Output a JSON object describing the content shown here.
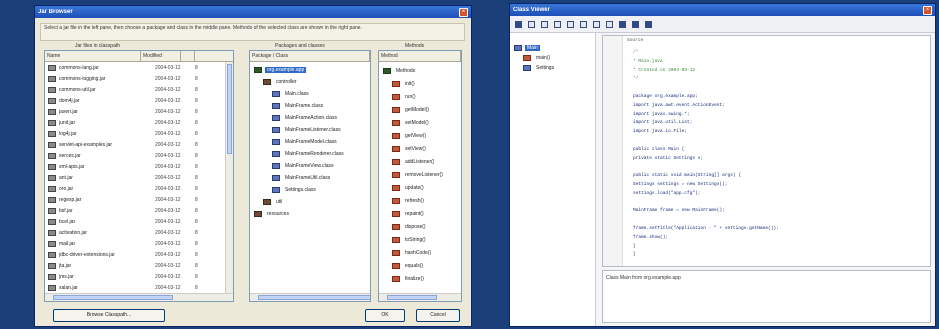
{
  "left_window": {
    "title": "Jar Browser",
    "close_glyph": "×",
    "description": "Select a jar file in the left pane, then choose a package and class in the middle pane. Methods of the selected class are shown in the right pane.",
    "files_group_label": "Jar files in classpath",
    "tree_group_label": "Packages and classes",
    "methods_group_label": "Methods",
    "files_headers": {
      "name": "Name",
      "date": "Modified",
      "size": ""
    },
    "files": [
      {
        "name": "commons-lang.jar",
        "date": "2004-03-12",
        "size": "8"
      },
      {
        "name": "commons-logging.jar",
        "date": "2004-03-12",
        "size": "8"
      },
      {
        "name": "commons-util.jar",
        "date": "2004-03-12",
        "size": "8"
      },
      {
        "name": "dom4j.jar",
        "date": "2004-03-12",
        "size": "8"
      },
      {
        "name": "jaxen.jar",
        "date": "2004-03-12",
        "size": "8"
      },
      {
        "name": "junit.jar",
        "date": "2004-03-12",
        "size": "8"
      },
      {
        "name": "log4j.jar",
        "date": "2004-03-12",
        "size": "8"
      },
      {
        "name": "servlet-api-examples.jar",
        "date": "2004-03-12",
        "size": "8"
      },
      {
        "name": "xerces.jar",
        "date": "2004-03-12",
        "size": "8"
      },
      {
        "name": "xml-apis.jar",
        "date": "2004-03-12",
        "size": "8"
      },
      {
        "name": "ant.jar",
        "date": "2004-03-12",
        "size": "8"
      },
      {
        "name": "oro.jar",
        "date": "2004-03-12",
        "size": "8"
      },
      {
        "name": "regexp.jar",
        "date": "2004-03-12",
        "size": "8"
      },
      {
        "name": "bsf.jar",
        "date": "2004-03-12",
        "size": "8"
      },
      {
        "name": "bcel.jar",
        "date": "2004-03-12",
        "size": "8"
      },
      {
        "name": "activation.jar",
        "date": "2004-03-12",
        "size": "8"
      },
      {
        "name": "mail.jar",
        "date": "2004-03-12",
        "size": "8"
      },
      {
        "name": "jdbc-driver-extensions.jar",
        "date": "2004-03-12",
        "size": "8"
      },
      {
        "name": "jta.jar",
        "date": "2004-03-12",
        "size": "8"
      },
      {
        "name": "jms.jar",
        "date": "2004-03-12",
        "size": "8"
      },
      {
        "name": "xalan.jar",
        "date": "2004-03-12",
        "size": "8"
      }
    ],
    "tree_header": "Package / Class",
    "tree": [
      {
        "label": "org.example.app",
        "level": 0,
        "icon": "root",
        "selected": true
      },
      {
        "label": "controller",
        "level": 1,
        "icon": "pkg"
      },
      {
        "label": "Main.class",
        "level": 2,
        "icon": "cls"
      },
      {
        "label": "MainFrame.class",
        "level": 2,
        "icon": "cls"
      },
      {
        "label": "MainFrameAction.class",
        "level": 2,
        "icon": "cls"
      },
      {
        "label": "MainFrameListener.class",
        "level": 2,
        "icon": "cls"
      },
      {
        "label": "MainFrameModel.class",
        "level": 2,
        "icon": "cls"
      },
      {
        "label": "MainFrameRenderer.class",
        "level": 2,
        "icon": "cls"
      },
      {
        "label": "MainFrameView.class",
        "level": 2,
        "icon": "cls"
      },
      {
        "label": "MainFrameUtil.class",
        "level": 2,
        "icon": "cls"
      },
      {
        "label": "Settings.class",
        "level": 2,
        "icon": "cls"
      },
      {
        "label": "util",
        "level": 1,
        "icon": "pkg"
      },
      {
        "label": "resources",
        "level": 0,
        "icon": "pkg"
      }
    ],
    "methods_header": "Method",
    "methods": [
      {
        "label": "Methods",
        "level": 0,
        "icon": "root"
      },
      {
        "label": "init()",
        "level": 1,
        "icon": "mth"
      },
      {
        "label": "run()",
        "level": 1,
        "icon": "mth"
      },
      {
        "label": "getModel()",
        "level": 1,
        "icon": "mth"
      },
      {
        "label": "setModel()",
        "level": 1,
        "icon": "mth"
      },
      {
        "label": "getView()",
        "level": 1,
        "icon": "mth"
      },
      {
        "label": "setView()",
        "level": 1,
        "icon": "mth"
      },
      {
        "label": "addListener()",
        "level": 1,
        "icon": "mth"
      },
      {
        "label": "removeListener()",
        "level": 1,
        "icon": "mth"
      },
      {
        "label": "update()",
        "level": 1,
        "icon": "mth"
      },
      {
        "label": "refresh()",
        "level": 1,
        "icon": "mth"
      },
      {
        "label": "repaint()",
        "level": 1,
        "icon": "mth"
      },
      {
        "label": "dispose()",
        "level": 1,
        "icon": "mth"
      },
      {
        "label": "toString()",
        "level": 1,
        "icon": "mth"
      },
      {
        "label": "hashCode()",
        "level": 1,
        "icon": "mth"
      },
      {
        "label": "equals()",
        "level": 1,
        "icon": "mth"
      },
      {
        "label": "finalize()",
        "level": 1,
        "icon": "mth"
      }
    ],
    "buttons": {
      "browse": "Browse Classpath...",
      "ok": "OK",
      "cancel": "Cancel"
    }
  },
  "right_window": {
    "title": "Class Viewer",
    "close_glyph": "×",
    "outline": [
      {
        "label": "Main",
        "level": 0,
        "icon": "cls",
        "selected": true
      },
      {
        "label": "main()",
        "level": 1,
        "icon": "mth"
      },
      {
        "label": "Settings",
        "level": 1,
        "icon": "cls"
      }
    ],
    "editor_header": "Source",
    "code": [
      {
        "text": "/*",
        "kind": "comment"
      },
      {
        "text": " * Main.java",
        "kind": "comment"
      },
      {
        "text": " * Created on 2004-03-12",
        "kind": "comment"
      },
      {
        "text": " */",
        "kind": "comment"
      },
      {
        "text": "",
        "kind": "code"
      },
      {
        "text": "package org.example.app;",
        "kind": "code"
      },
      {
        "text": "import java.awt.event.ActionEvent;",
        "kind": "code"
      },
      {
        "text": "import javax.swing.*;",
        "kind": "code"
      },
      {
        "text": "import java.util.List;",
        "kind": "code"
      },
      {
        "text": "import java.io.File;",
        "kind": "code"
      },
      {
        "text": "",
        "kind": "code"
      },
      {
        "text": "public class Main {",
        "kind": "code"
      },
      {
        "text": "  private static Settings s;",
        "kind": "code"
      },
      {
        "text": "",
        "kind": "code"
      },
      {
        "text": "  public static void main(String[] args) {",
        "kind": "code"
      },
      {
        "text": "    Settings settings = new Settings();",
        "kind": "code"
      },
      {
        "text": "    settings.load(\"app.cfg\");",
        "kind": "code"
      },
      {
        "text": "",
        "kind": "code"
      },
      {
        "text": "    MainFrame frame = new MainFrame();",
        "kind": "code"
      },
      {
        "text": "",
        "kind": "code"
      },
      {
        "text": "      frame.setTitle(\"Application - \" + settings.getName());",
        "kind": "code"
      },
      {
        "text": "      frame.show();",
        "kind": "code"
      },
      {
        "text": "  }",
        "kind": "code"
      },
      {
        "text": "}",
        "kind": "code"
      }
    ],
    "status_text": "Class Main from org.example.app"
  }
}
